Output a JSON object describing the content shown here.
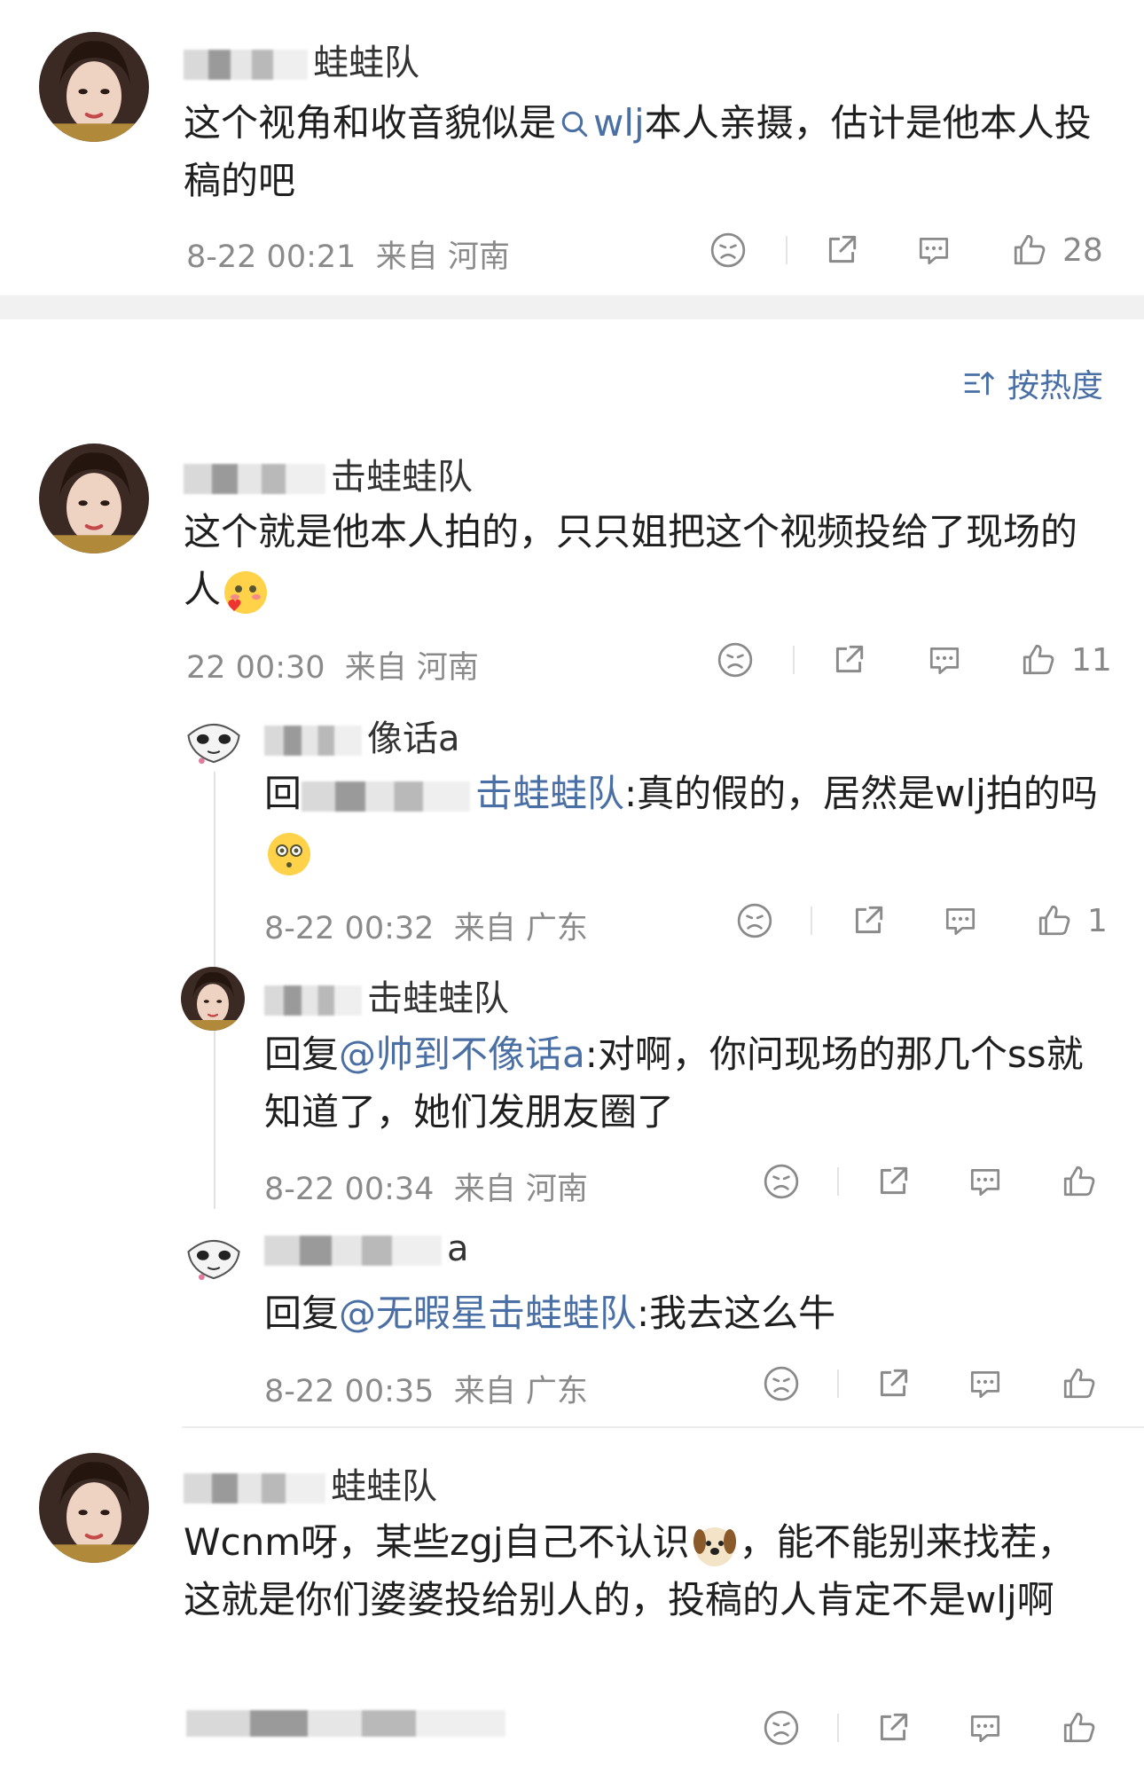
{
  "sort_label": "按热度",
  "comments": [
    {
      "name_suffix": "蛙蛙队",
      "body_before": "这个视角和收音貌似是",
      "body_link": "wlj",
      "body_after": "本人亲摄，估计是他本人投稿的吧",
      "time": "8-22 00:21",
      "location": "来自 河南",
      "likes": "28"
    },
    {
      "name_suffix": "击蛙蛙队",
      "body": "这个就是他本人拍的，只只姐把这个视频投给了现场的人",
      "time": "22 00:30",
      "location": "来自 河南",
      "likes": "11"
    },
    {
      "name_suffix": "像话a",
      "reply_prefix": "回",
      "reply_target": "击蛙蛙队",
      "body": ":真的假的，居然是wlj拍的吗",
      "time": "8-22 00:32",
      "location": "来自 广东",
      "likes": "1"
    },
    {
      "name_suffix": "击蛙蛙队",
      "reply_prefix": "回复",
      "reply_target": "@帅到不像话a",
      "body": ":对啊，你问现场的那几个ss就知道了，她们发朋友圈了",
      "time": "8-22 00:34",
      "location": "来自 河南",
      "likes": ""
    },
    {
      "name_suffix": "a",
      "reply_prefix": "回复",
      "reply_target": "@无暇星击蛙蛙队",
      "body": ":我去这么牛",
      "time": "8-22 00:35",
      "location": "来自 广东",
      "likes": ""
    },
    {
      "name_suffix": "蛙蛙队",
      "body_part1": "Wcnm呀，某些zgj自己不认识",
      "body_part2": "，能不能别来找茬，这就是你们婆婆投给别人的，投稿的人肯定不是wlj啊",
      "likes": ""
    }
  ],
  "icons": {
    "dislike": "sad-face-icon",
    "share": "share-icon",
    "comment": "comment-bubble-icon",
    "like": "thumbs-up-icon",
    "search": "search-icon",
    "sort": "sort-icon"
  },
  "colors": {
    "link": "#4a6fa5",
    "meta": "#8a8a8a",
    "separator_band": "#f1f1f1"
  }
}
